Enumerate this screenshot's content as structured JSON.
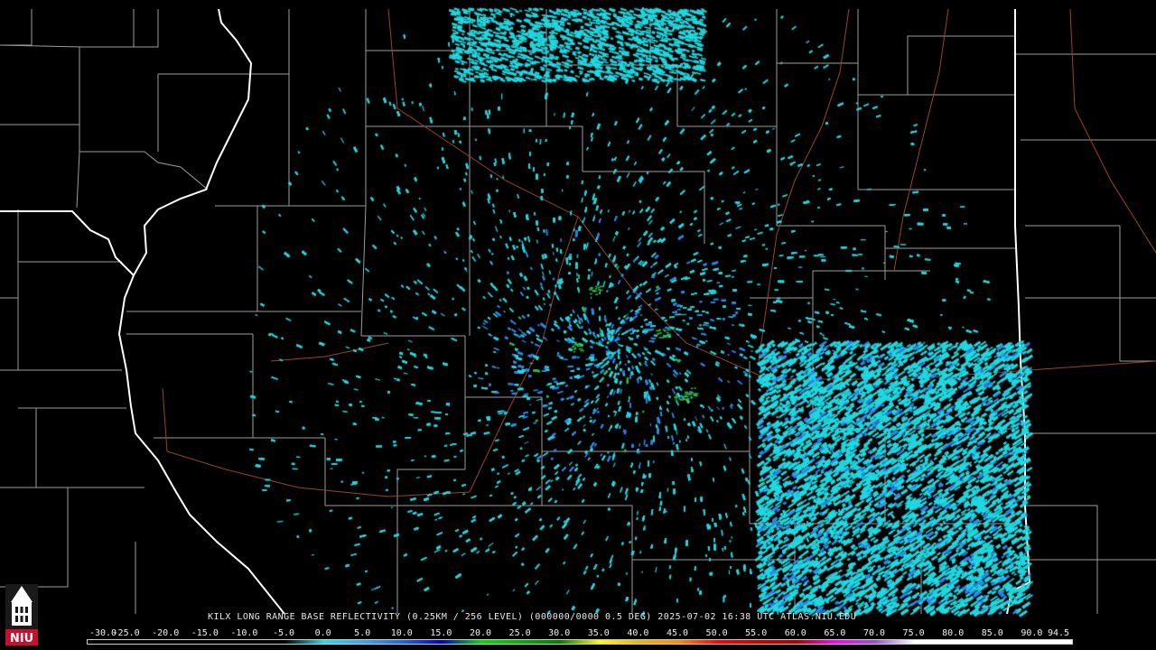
{
  "product_title": "KILX LONG RANGE BASE REFLECTIVITY (0.25KM / 256 LEVEL) (000000/0000 0.5 DEG) 2025-07-02 16:38 UTC  ATLAS.NIU.EDU",
  "logo": {
    "text": "NIU",
    "icon": "university-tower-icon",
    "color": "#c8102e"
  },
  "colorbar": {
    "labels": [
      "-30.0",
      "-25.0",
      "-20.0",
      "-15.0",
      "-10.0",
      "-5.0",
      "0.0",
      "5.0",
      "10.0",
      "15.0",
      "20.0",
      "25.0",
      "30.0",
      "35.0",
      "40.0",
      "45.0",
      "50.0",
      "55.0",
      "60.0",
      "65.0",
      "70.0",
      "75.0",
      "80.0",
      "85.0",
      "90.0",
      "94.5"
    ],
    "colors": [
      "#000000",
      "#000000",
      "#000000",
      "#000000",
      "#000000",
      "#000000",
      "#20e0e8",
      "#30a8f0",
      "#1e64e8",
      "#0000c8",
      "#00e000",
      "#00b000",
      "#008000",
      "#ffff00",
      "#e8b800",
      "#ff8c00",
      "#ff0000",
      "#d00000",
      "#b00000",
      "#ff00ff",
      "#9850c8",
      "#ffffff",
      "#ffffff",
      "#ffffff",
      "#ffffff",
      "#ffffff"
    ]
  },
  "map": {
    "radar_site": "KILX",
    "colors": {
      "state_border": "#ffffff",
      "county_line": "#c8c8c8",
      "highway": "#a04a2a",
      "echo_main": "#20d8e0",
      "echo_blue": "#2a86e8",
      "echo_green": "#28c040"
    }
  }
}
